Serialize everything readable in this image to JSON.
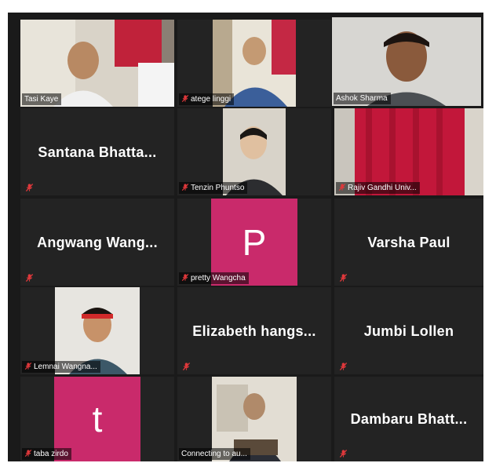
{
  "colors": {
    "background": "#1a1a1a",
    "tile": "#232323",
    "active_speaker_border": "#e2e86a",
    "avatar_pink": "#c92a6b",
    "muted_mic": "#e0383b"
  },
  "participants": [
    {
      "name": "Tasi Kaye",
      "type": "video",
      "muted": false
    },
    {
      "name": "atege linggi",
      "type": "video",
      "muted": true
    },
    {
      "name": "Ashok Sharma",
      "type": "video",
      "muted": false,
      "active_speaker": true
    },
    {
      "name": "Santana  Bhatta...",
      "type": "name",
      "muted": true
    },
    {
      "name": "Tenzin Phuntso",
      "type": "video",
      "muted": true
    },
    {
      "name": "Rajiv Gandhi Univ...",
      "type": "video",
      "muted": true
    },
    {
      "name": "Angwang  Wang...",
      "type": "name",
      "muted": true
    },
    {
      "name": "pretty Wangcha",
      "type": "avatar",
      "initial": "P",
      "muted": true
    },
    {
      "name": "Varsha Paul",
      "type": "name",
      "muted": true
    },
    {
      "name": "Lemnai Wangna...",
      "type": "video",
      "muted": true
    },
    {
      "name": "Elizabeth  hangs...",
      "type": "name",
      "muted": true
    },
    {
      "name": "Jumbi Lollen",
      "type": "name",
      "muted": true
    },
    {
      "name": "taba zirdo",
      "type": "avatar",
      "initial": "t",
      "muted": true
    },
    {
      "name": "Connecting to au...",
      "type": "video",
      "muted": false
    },
    {
      "name": "Dambaru  Bhatt...",
      "type": "name",
      "muted": true
    }
  ]
}
